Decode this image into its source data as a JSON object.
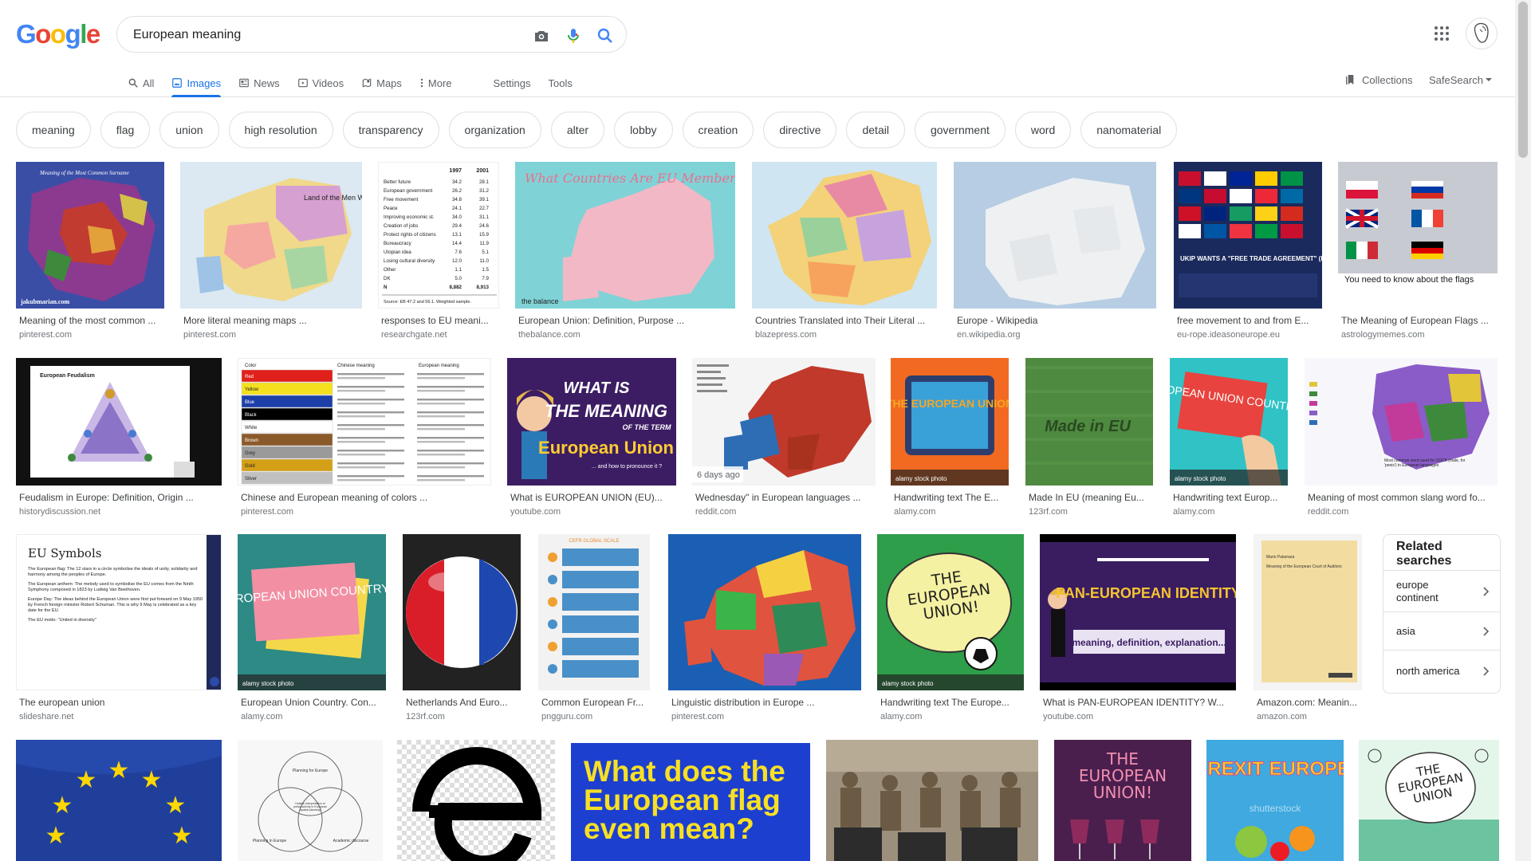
{
  "search": {
    "query": "European meaning"
  },
  "tabs": [
    "All",
    "Images",
    "News",
    "Videos",
    "Maps",
    "More",
    "Settings",
    "Tools"
  ],
  "header": {
    "collections": "Collections",
    "safesearch": "SafeSearch"
  },
  "chips": [
    "meaning",
    "flag",
    "union",
    "high resolution",
    "transparency",
    "organization",
    "alter",
    "lobby",
    "creation",
    "directive",
    "detail",
    "government",
    "word",
    "nanomaterial"
  ],
  "results": [
    {
      "title": "Meaning of the most common ...",
      "source": "pinterest.com"
    },
    {
      "title": "More literal meaning maps ...",
      "source": "pinterest.com"
    },
    {
      "title": "responses to EU meani...",
      "source": "researchgate.net"
    },
    {
      "title": "European Union: Definition, Purpose ...",
      "source": "thebalance.com"
    },
    {
      "title": "Countries Translated into Their Literal ...",
      "source": "blazepress.com"
    },
    {
      "title": "Europe - Wikipedia",
      "source": "en.wikipedia.org"
    },
    {
      "title": "free movement to and from E...",
      "source": "eu-rope.ideasoneurope.eu"
    },
    {
      "title": "The Meaning of European Flags ...",
      "source": "astrologymemes.com"
    },
    {
      "title": "Feudalism in Europe: Definition, Origin ...",
      "source": "historydiscussion.net"
    },
    {
      "title": "Chinese and European meaning of colors ...",
      "source": "pinterest.com"
    },
    {
      "title": "What is EUROPEAN UNION (EU)...",
      "source": "youtube.com"
    },
    {
      "title": "Wednesday\" in European languages ...",
      "source": "reddit.com"
    },
    {
      "title": "Handwriting text The E...",
      "source": "alamy.com"
    },
    {
      "title": "Made In EU (meaning Eu...",
      "source": "123rf.com"
    },
    {
      "title": "Handwriting text Europ...",
      "source": "alamy.com"
    },
    {
      "title": "Meaning of most common slang word fo...",
      "source": "reddit.com"
    },
    {
      "title": "The european union",
      "source": "slideshare.net"
    },
    {
      "title": "European Union Country. Con...",
      "source": "alamy.com"
    },
    {
      "title": "Netherlands And Euro...",
      "source": "123rf.com"
    },
    {
      "title": "Common European Fr...",
      "source": "pngguru.com"
    },
    {
      "title": "Linguistic distribution in Europe ...",
      "source": "pinterest.com"
    },
    {
      "title": "Handwriting text The Europe...",
      "source": "alamy.com"
    },
    {
      "title": "What is PAN-EUROPEAN IDENTITY? W...",
      "source": "youtube.com"
    },
    {
      "title": "Amazon.com: Meanin...",
      "source": "amazon.com"
    }
  ],
  "thumb_text": {
    "map_title": "Meaning of the Most Common Surname",
    "map_credit": "jakubmarian.com",
    "land_label": "Land of the Men Who Row",
    "table_years": [
      "1997",
      "2001"
    ],
    "table_rows": [
      [
        "Better future",
        "34.2",
        "28.1"
      ],
      [
        "European government",
        "26.2",
        "31.2"
      ],
      [
        "Free movement",
        "34.8",
        "39.1"
      ],
      [
        "Peace",
        "24.1",
        "22.7"
      ],
      [
        "Improving economic st.",
        "34.0",
        "31.1"
      ],
      [
        "Creation of jobs",
        "29.4",
        "24.6"
      ],
      [
        "Protect rights of citizens",
        "13.1",
        "15.9"
      ],
      [
        "Bureaucracy",
        "14.4",
        "11.9"
      ],
      [
        "Utopian idea",
        "7.6",
        "5.1"
      ],
      [
        "Losing cultural diversity",
        "12.0",
        "11.0"
      ],
      [
        "Other",
        "1.1",
        "1.5"
      ],
      [
        "DK",
        "5.0",
        "7.9"
      ],
      [
        "N",
        "8,882",
        "8,913"
      ]
    ],
    "table_source": "Source: EB 47.2 and 56.1. Weighted sample.",
    "balance_q": "What Countries Are EU Members?",
    "balance_brand": "the balance",
    "ukip_text": "UKIP WANTS A \"FREE TRADE AGREEMENT\" (FTA) WITH EUROPE. WHAT WOULD THIS MEAN?",
    "flags_caption": "You need to know about the flags",
    "feudalism_title": "European Feudalism",
    "colors_head": [
      "Color",
      "Chinese meaning",
      "European meaning"
    ],
    "colors_rows": [
      "Red",
      "Yellow",
      "Blue",
      "Black",
      "White",
      "Brown",
      "Grey",
      "Gold",
      "Silver"
    ],
    "what_is_1": "WHAT IS",
    "what_is_2": "THE MEANING",
    "what_is_3": "OF THE TERM",
    "what_is_4": "European Union",
    "what_is_5": "... and how to pronounce it ?",
    "days_ago": "6 days ago",
    "alamy_text": "THE EUROPEAN UNION",
    "alamy_brand": "alamy stock photo",
    "made_in_eu": "Made in EU",
    "eu_country": "EUROPEAN UNION COUNTRY!",
    "slang_caption": "Most common word used for COCK (male, for 'penis') in European languages",
    "eu_symbols": "EU Symbols",
    "eu_symbols_lines": [
      "The European flag: The 12 stars in a circle symbolise the ideals of unity, solidarity and harmony among the peoples of Europe.",
      "The European anthem: The melody used to symbolise the EU comes from the Ninth Symphony composed in 1823 by Ludwig Van Beethoven.",
      "Europe Day: The ideas behind the European Union were first put forward on 9 May 1950 by French foreign minister Robert Schuman. This is why 9 May is celebrated as a key date for the EU.",
      "The EU motto: \"United in diversity\""
    ],
    "eu_country_pink": "EUROPEAN UNION COUNTRY!",
    "pngguru_head": "CEFR GLOBAL SCALE",
    "eu_green": "THE EUROPEAN UNION!",
    "pan_eu": "PAN-EUROPEAN IDENTITY",
    "pan_eu_sub": "meaning, definition, explanation...",
    "amazon_title": "Meaning of the European Court of Auditors",
    "amazon_author": "Mario Palamara",
    "venn_title": "Planning for Europe",
    "venn_left": "Planning in Europe",
    "venn_right": "Academic discourse",
    "venn_center": "Holistic interpretation of policy-activity in European spatial planning",
    "eu_flag_q": "What does the European flag even mean?",
    "purple_text": "THE EUROPEAN UNION!",
    "brexit": "BREXIT EUROPE!",
    "brexit_wm": "shutterstock",
    "sketch_text": "THE EUROPEAN UNION"
  },
  "related": {
    "title": "Related searches",
    "items": [
      "europe continent",
      "asia",
      "north america"
    ]
  },
  "colors": {
    "accent": "#1a73e8",
    "chip_border": "#dfe1e5",
    "source": "#70757a"
  }
}
